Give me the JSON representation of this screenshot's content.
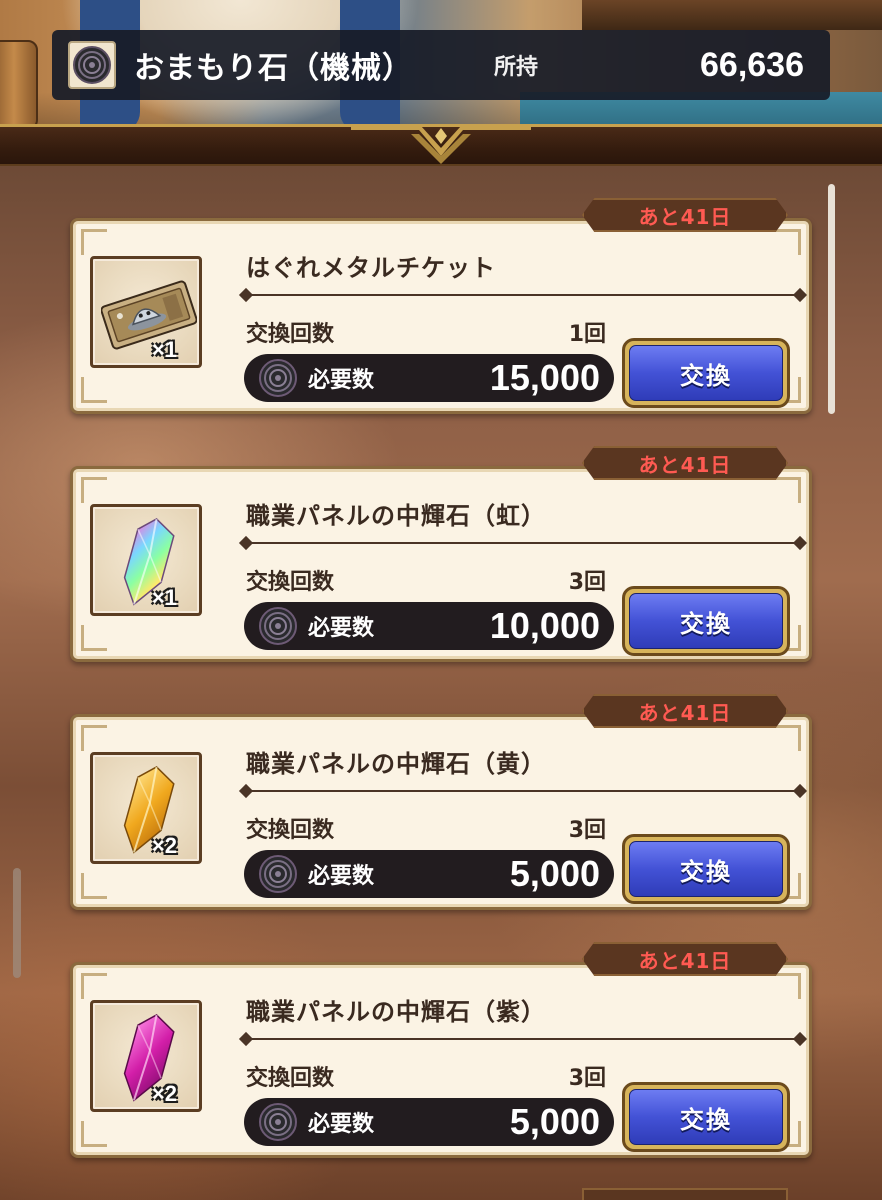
{
  "header": {
    "currency_name": "おまもり石（機械）",
    "own_label": "所持",
    "own_count": "66,636"
  },
  "items": [
    {
      "remaining": "あと41日",
      "name": "はぐれメタルチケット",
      "quantity": "×1",
      "icon": "metal-ticket-icon",
      "exchange_count_label": "交換回数",
      "exchange_count": "1回",
      "required_label": "必要数",
      "required_amount": "15,000",
      "button_label": "交換"
    },
    {
      "remaining": "あと41日",
      "name": "職業パネルの中輝石（虹）",
      "quantity": "×1",
      "icon": "rainbow-crystal-icon",
      "exchange_count_label": "交換回数",
      "exchange_count": "3回",
      "required_label": "必要数",
      "required_amount": "10,000",
      "button_label": "交換"
    },
    {
      "remaining": "あと41日",
      "name": "職業パネルの中輝石（黄）",
      "quantity": "×2",
      "icon": "yellow-crystal-icon",
      "exchange_count_label": "交換回数",
      "exchange_count": "3回",
      "required_label": "必要数",
      "required_amount": "5,000",
      "button_label": "交換"
    },
    {
      "remaining": "あと41日",
      "name": "職業パネルの中輝石（紫）",
      "quantity": "×2",
      "icon": "purple-crystal-icon",
      "exchange_count_label": "交換回数",
      "exchange_count": "3回",
      "required_label": "必要数",
      "required_amount": "5,000",
      "button_label": "交換"
    }
  ],
  "colors": {
    "remaining_text": "#ff5a52",
    "button_blue": "#4352d6",
    "card_bg": "#fbf3e4"
  }
}
